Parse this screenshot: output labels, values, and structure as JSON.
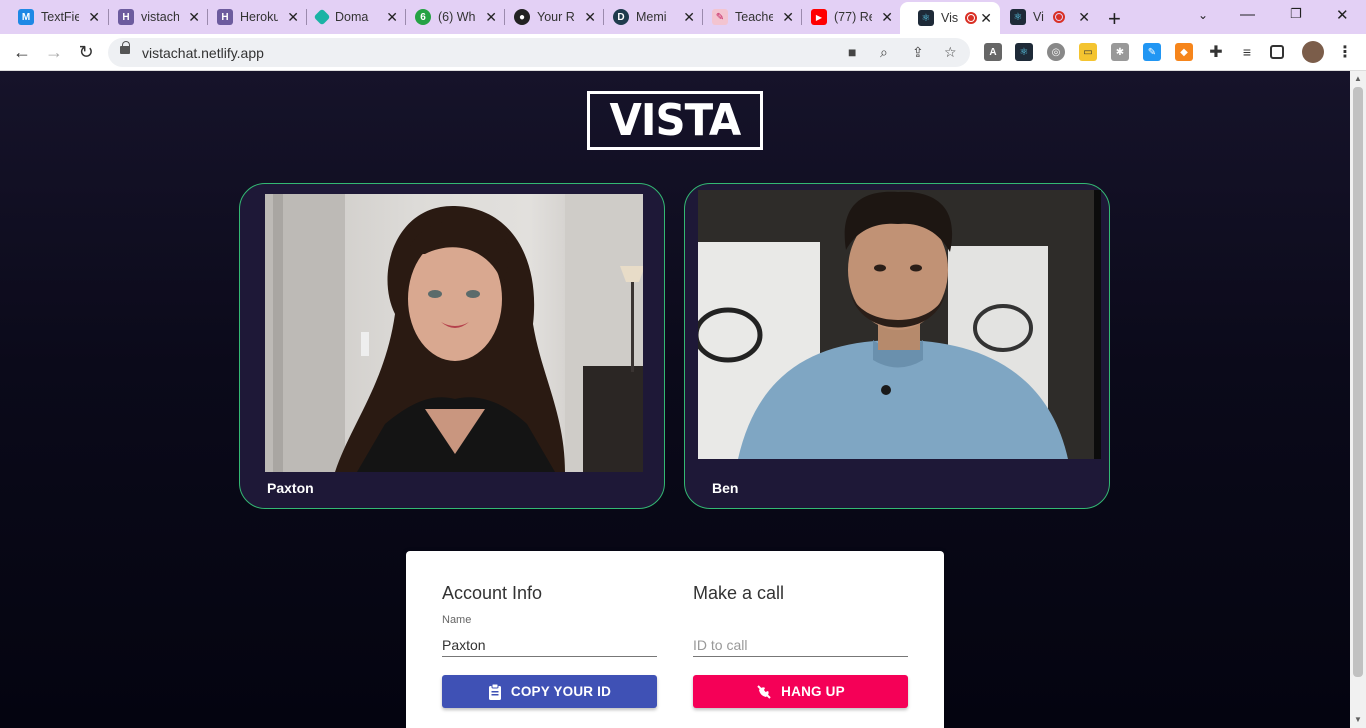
{
  "browser": {
    "tabs": [
      {
        "title": "TextFie",
        "fav": "MUI",
        "fav_color": "#1e88e5"
      },
      {
        "title": "vistach",
        "fav": "H",
        "fav_color": "#6c5b9e"
      },
      {
        "title": "Heroku",
        "fav": "H",
        "fav_color": "#6c5b9e"
      },
      {
        "title": "Doma",
        "fav": "◆",
        "fav_color": "#1bb3a5"
      },
      {
        "title": "(6) Wh",
        "fav": "6",
        "fav_color": "#25a244"
      },
      {
        "title": "Your R",
        "fav": "●",
        "fav_color": "#222222"
      },
      {
        "title": "Memi",
        "fav": "D",
        "fav_color": "#1f3b4d"
      },
      {
        "title": "Teache",
        "fav": "✎",
        "fav_color": "#e57373"
      },
      {
        "title": "(77) Re",
        "fav": "▶",
        "fav_color": "#ff0000"
      },
      {
        "title": "Vis",
        "fav": "⚛",
        "fav_color": "#1e2a38"
      },
      {
        "title": "Vi",
        "fav": "⚛",
        "fav_color": "#1e2a38"
      }
    ],
    "url": "vistachat.netlify.app"
  },
  "app": {
    "logo_text": "VISTA",
    "participants": [
      {
        "name": "Paxton"
      },
      {
        "name": "Ben"
      }
    ],
    "account": {
      "title": "Account Info",
      "name_label": "Name",
      "name_value": "Paxton",
      "copy_button": "COPY YOUR ID"
    },
    "call": {
      "title": "Make a call",
      "id_placeholder": "ID to call",
      "hangup_button": "HANG UP"
    }
  },
  "colors": {
    "accent_border": "#33b873",
    "primary_button": "#3f51b5",
    "hangup_button": "#f50057"
  }
}
